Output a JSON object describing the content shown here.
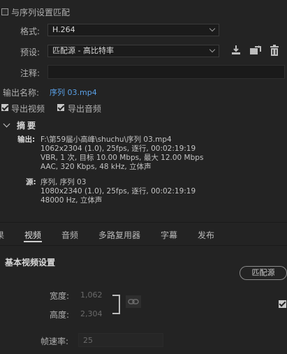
{
  "match_sequence": {
    "label": "与序列设置匹配",
    "checked": false
  },
  "format": {
    "label": "格式:",
    "value": "H.264"
  },
  "preset": {
    "label": "预设:",
    "value": "匹配源 - 高比特率"
  },
  "comment": {
    "label": "注释:",
    "value": ""
  },
  "output_name": {
    "label": "输出名称:",
    "value": "序列 03.mp4"
  },
  "export_video": {
    "label": "导出视频",
    "checked": true
  },
  "export_audio": {
    "label": "导出音频",
    "checked": true
  },
  "summary": {
    "title": "摘要",
    "output_label": "输出:",
    "output_lines": [
      "F:\\第59届小高峰\\shuchu\\序列 03.mp4",
      "1062x2304 (1.0), 25fps, 逐行, 00:02:19:19",
      "VBR, 1 次, 目标 10.00 Mbps, 最大 12.00 Mbps",
      "AAC, 320 Kbps, 48 kHz, 立体声"
    ],
    "source_label": "源:",
    "source_lines": [
      "序列, 序列 03",
      "1080x2340 (1.0), 25fps, 逐行, 00:02:19:19",
      "48000 Hz, 立体声"
    ]
  },
  "tabs": [
    "果",
    "视频",
    "音频",
    "多路复用器",
    "字幕",
    "发布"
  ],
  "active_tab": "视频",
  "basic_video": {
    "title": "基本视频设置",
    "match_source_button": "匹配源",
    "width_label": "宽度:",
    "width_value": "1,062",
    "height_label": "高度:",
    "height_value": "2,304",
    "framerate_label": "帧速率:",
    "framerate_value": "25"
  },
  "icons": [
    "import-preset-icon",
    "save-preset-icon",
    "delete-preset-icon",
    "collapse-chevron-icon",
    "link-icon",
    "checkbox-icon"
  ]
}
